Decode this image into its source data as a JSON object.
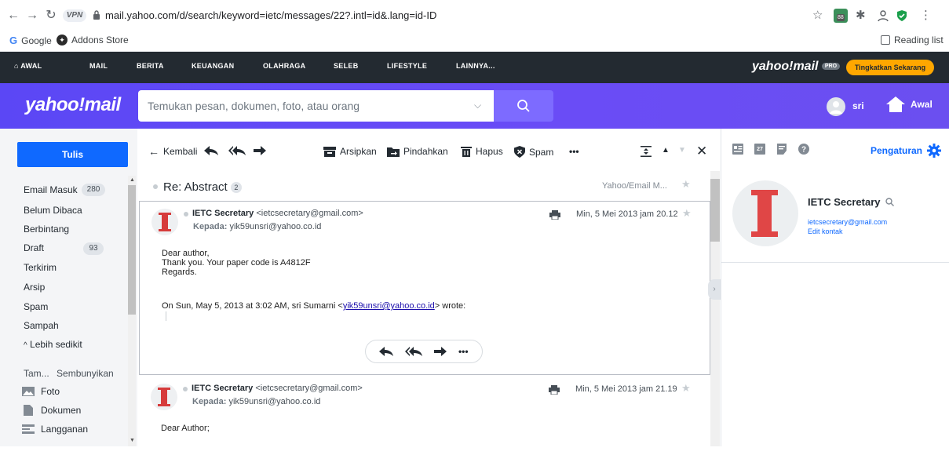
{
  "browser": {
    "vpn_label": "VPN",
    "url": "mail.yahoo.com/d/search/keyword=ietc/messages/22?.intl=id&.lang=id-ID",
    "extension_badge": "88",
    "bookmarks": [
      {
        "label": "Google"
      },
      {
        "label": "Addons Store"
      }
    ],
    "reading_list": "Reading list"
  },
  "topnav": {
    "items": [
      "AWAL",
      "MAIL",
      "BERITA",
      "KEUANGAN",
      "OLAHRAGA",
      "SELEB",
      "LIFESTYLE",
      "LAINNYA..."
    ],
    "logo": "yahoo!mail",
    "pro_badge": "PRO",
    "upgrade_label": "Tingkatkan Sekarang"
  },
  "header": {
    "logo": "yahoo!mail",
    "search_placeholder": "Temukan pesan, dokumen, foto, atau orang",
    "user_name": "sri",
    "home_label": "Awal"
  },
  "sidebar": {
    "compose_label": "Tulis",
    "folders": [
      {
        "label": "Email Masuk",
        "count": "280"
      },
      {
        "label": "Belum Dibaca",
        "count": ""
      },
      {
        "label": "Berbintang",
        "count": ""
      },
      {
        "label": "Draft",
        "count": "93"
      },
      {
        "label": "Terkirim",
        "count": ""
      },
      {
        "label": "Arsip",
        "count": ""
      },
      {
        "label": "Spam",
        "count": ""
      },
      {
        "label": "Sampah",
        "count": ""
      }
    ],
    "less_label": "Lebih sedikit",
    "views_label": "Tam...",
    "hide_label": "Sembunyikan",
    "views": [
      {
        "label": "Foto",
        "icon": "photo-icon"
      },
      {
        "label": "Dokumen",
        "icon": "document-icon"
      },
      {
        "label": "Langganan",
        "icon": "subscription-icon"
      }
    ]
  },
  "toolbar": {
    "back_label": "Kembali",
    "archive_label": "Arsipkan",
    "move_label": "Pindahkan",
    "delete_label": "Hapus",
    "spam_label": "Spam",
    "more_label": "•••"
  },
  "thread": {
    "subject": "Re: Abstract",
    "count": "2",
    "folder_tag": "Yahoo/Email M...",
    "messages": [
      {
        "sender_name": "IETC Secretary",
        "sender_email": "<ietcsecretary@gmail.com>",
        "to_label": "Kepada:",
        "to": "yik59unsri@yahoo.co.id",
        "date": "Min, 5 Mei 2013 jam 20.12",
        "lines": [
          "Dear author,",
          "Thank you. Your paper code is A4812F",
          "Regards."
        ],
        "quote_prefix": "On Sun, May 5, 2013 at 3:02 AM, sri Sumarni <",
        "quote_email": "yik59unsri@yahoo.co.id",
        "quote_suffix": "> wrote:"
      },
      {
        "sender_name": "IETC Secretary",
        "sender_email": "<ietcsecretary@gmail.com>",
        "to_label": "Kepada:",
        "to": "yik59unsri@yahoo.co.id",
        "date": "Min, 5 Mei 2013 jam 21.19",
        "lines": [
          "Dear Author;"
        ]
      }
    ]
  },
  "right_panel": {
    "settings_label": "Pengaturan",
    "calendar_day": "27",
    "contact_name": "IETC Secretary",
    "contact_email": "ietcsecretary@gmail.com",
    "edit_label": "Edit kontak"
  },
  "colors": {
    "header_purple": "#6a4cf6",
    "nav_dark": "#232a31",
    "compose_blue": "#0f69ff",
    "upgrade_orange": "#ffa700"
  }
}
